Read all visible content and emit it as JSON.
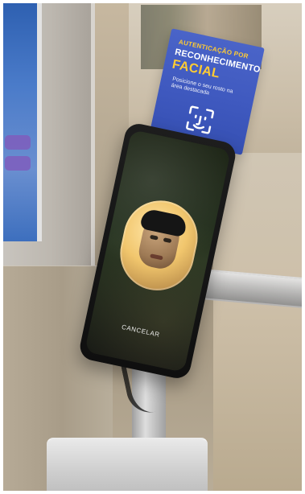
{
  "sign": {
    "line1": "AUTENTICAÇÃO POR",
    "line2": "RECONHECIMENTO",
    "line3": "FACIAL",
    "small_text": "Posicione o seu rosto na área destacada",
    "icon": "face-id-icon"
  },
  "phone": {
    "cancel_label": "CANCELAR"
  },
  "colors": {
    "sign_blue": "#3f59bf",
    "sign_yellow": "#ffcc33"
  }
}
